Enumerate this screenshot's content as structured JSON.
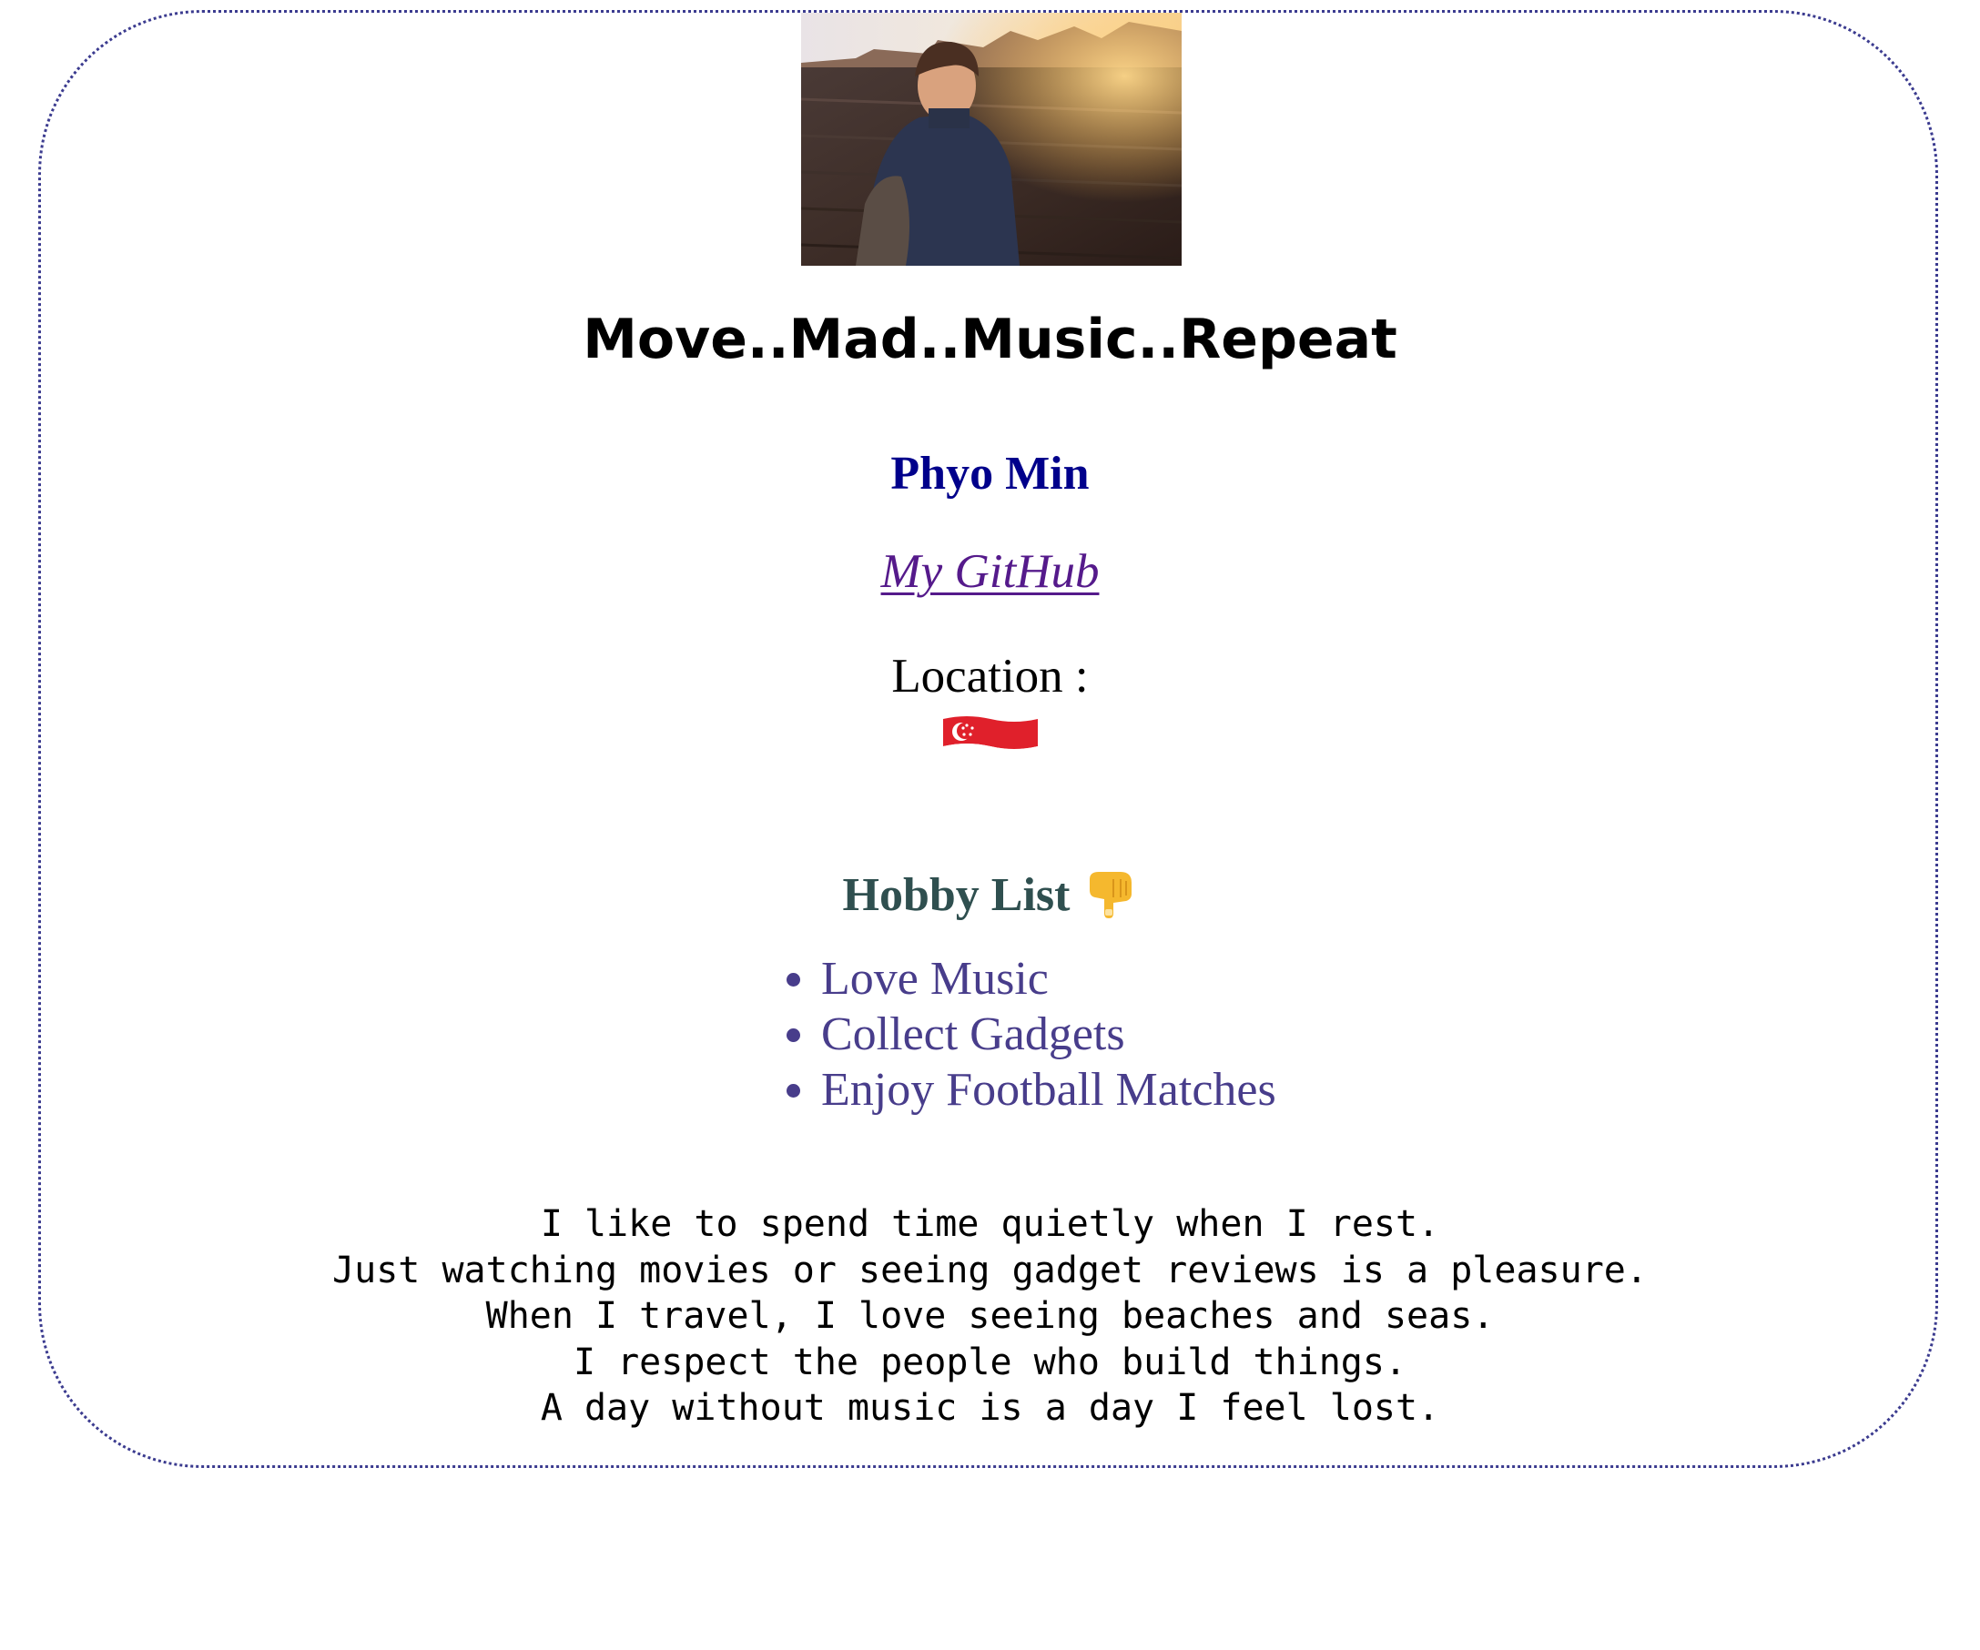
{
  "page": {
    "title": "Move..Mad..Music..Repeat",
    "name": "Phyo Min",
    "github_link_text": "My GitHub",
    "location_label": "Location :"
  },
  "hobbies": {
    "title": "Hobby List",
    "items": [
      "Love Music",
      "Collect Gadgets",
      "Enjoy Football Matches"
    ]
  },
  "poem": {
    "lines": [
      "I like to spend time quietly when I rest.",
      "Just watching movies or seeing gadget reviews is a pleasure.",
      "When I travel, I love seeing beaches and seas.",
      "I respect the people who build things.",
      "A day without music is a day I feel lost."
    ]
  },
  "icons": {
    "flag": "singapore-flag-icon",
    "pointer": "backhand-index-pointing-down-icon"
  },
  "colors": {
    "card_border": "#3b3b8f",
    "name": "#00008b",
    "link": "#551a8b",
    "hobby_title": "#2f4f4f",
    "hobby_items": "#483d8b"
  }
}
